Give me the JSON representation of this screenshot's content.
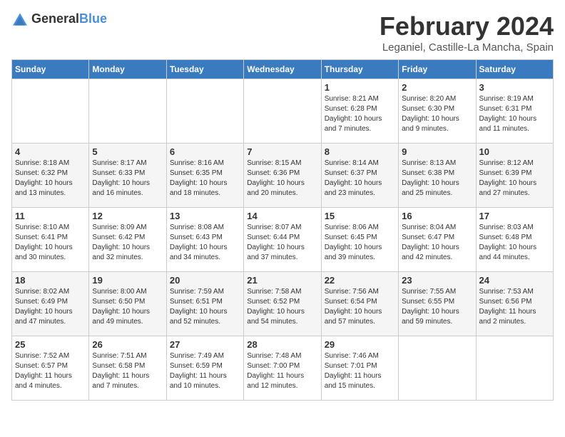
{
  "header": {
    "logo_general": "General",
    "logo_blue": "Blue",
    "month_title": "February 2024",
    "subtitle": "Leganiel, Castille-La Mancha, Spain"
  },
  "weekdays": [
    "Sunday",
    "Monday",
    "Tuesday",
    "Wednesday",
    "Thursday",
    "Friday",
    "Saturday"
  ],
  "weeks": [
    [
      {
        "day": "",
        "info": ""
      },
      {
        "day": "",
        "info": ""
      },
      {
        "day": "",
        "info": ""
      },
      {
        "day": "",
        "info": ""
      },
      {
        "day": "1",
        "info": "Sunrise: 8:21 AM\nSunset: 6:28 PM\nDaylight: 10 hours\nand 7 minutes."
      },
      {
        "day": "2",
        "info": "Sunrise: 8:20 AM\nSunset: 6:30 PM\nDaylight: 10 hours\nand 9 minutes."
      },
      {
        "day": "3",
        "info": "Sunrise: 8:19 AM\nSunset: 6:31 PM\nDaylight: 10 hours\nand 11 minutes."
      }
    ],
    [
      {
        "day": "4",
        "info": "Sunrise: 8:18 AM\nSunset: 6:32 PM\nDaylight: 10 hours\nand 13 minutes."
      },
      {
        "day": "5",
        "info": "Sunrise: 8:17 AM\nSunset: 6:33 PM\nDaylight: 10 hours\nand 16 minutes."
      },
      {
        "day": "6",
        "info": "Sunrise: 8:16 AM\nSunset: 6:35 PM\nDaylight: 10 hours\nand 18 minutes."
      },
      {
        "day": "7",
        "info": "Sunrise: 8:15 AM\nSunset: 6:36 PM\nDaylight: 10 hours\nand 20 minutes."
      },
      {
        "day": "8",
        "info": "Sunrise: 8:14 AM\nSunset: 6:37 PM\nDaylight: 10 hours\nand 23 minutes."
      },
      {
        "day": "9",
        "info": "Sunrise: 8:13 AM\nSunset: 6:38 PM\nDaylight: 10 hours\nand 25 minutes."
      },
      {
        "day": "10",
        "info": "Sunrise: 8:12 AM\nSunset: 6:39 PM\nDaylight: 10 hours\nand 27 minutes."
      }
    ],
    [
      {
        "day": "11",
        "info": "Sunrise: 8:10 AM\nSunset: 6:41 PM\nDaylight: 10 hours\nand 30 minutes."
      },
      {
        "day": "12",
        "info": "Sunrise: 8:09 AM\nSunset: 6:42 PM\nDaylight: 10 hours\nand 32 minutes."
      },
      {
        "day": "13",
        "info": "Sunrise: 8:08 AM\nSunset: 6:43 PM\nDaylight: 10 hours\nand 34 minutes."
      },
      {
        "day": "14",
        "info": "Sunrise: 8:07 AM\nSunset: 6:44 PM\nDaylight: 10 hours\nand 37 minutes."
      },
      {
        "day": "15",
        "info": "Sunrise: 8:06 AM\nSunset: 6:45 PM\nDaylight: 10 hours\nand 39 minutes."
      },
      {
        "day": "16",
        "info": "Sunrise: 8:04 AM\nSunset: 6:47 PM\nDaylight: 10 hours\nand 42 minutes."
      },
      {
        "day": "17",
        "info": "Sunrise: 8:03 AM\nSunset: 6:48 PM\nDaylight: 10 hours\nand 44 minutes."
      }
    ],
    [
      {
        "day": "18",
        "info": "Sunrise: 8:02 AM\nSunset: 6:49 PM\nDaylight: 10 hours\nand 47 minutes."
      },
      {
        "day": "19",
        "info": "Sunrise: 8:00 AM\nSunset: 6:50 PM\nDaylight: 10 hours\nand 49 minutes."
      },
      {
        "day": "20",
        "info": "Sunrise: 7:59 AM\nSunset: 6:51 PM\nDaylight: 10 hours\nand 52 minutes."
      },
      {
        "day": "21",
        "info": "Sunrise: 7:58 AM\nSunset: 6:52 PM\nDaylight: 10 hours\nand 54 minutes."
      },
      {
        "day": "22",
        "info": "Sunrise: 7:56 AM\nSunset: 6:54 PM\nDaylight: 10 hours\nand 57 minutes."
      },
      {
        "day": "23",
        "info": "Sunrise: 7:55 AM\nSunset: 6:55 PM\nDaylight: 10 hours\nand 59 minutes."
      },
      {
        "day": "24",
        "info": "Sunrise: 7:53 AM\nSunset: 6:56 PM\nDaylight: 11 hours\nand 2 minutes."
      }
    ],
    [
      {
        "day": "25",
        "info": "Sunrise: 7:52 AM\nSunset: 6:57 PM\nDaylight: 11 hours\nand 4 minutes."
      },
      {
        "day": "26",
        "info": "Sunrise: 7:51 AM\nSunset: 6:58 PM\nDaylight: 11 hours\nand 7 minutes."
      },
      {
        "day": "27",
        "info": "Sunrise: 7:49 AM\nSunset: 6:59 PM\nDaylight: 11 hours\nand 10 minutes."
      },
      {
        "day": "28",
        "info": "Sunrise: 7:48 AM\nSunset: 7:00 PM\nDaylight: 11 hours\nand 12 minutes."
      },
      {
        "day": "29",
        "info": "Sunrise: 7:46 AM\nSunset: 7:01 PM\nDaylight: 11 hours\nand 15 minutes."
      },
      {
        "day": "",
        "info": ""
      },
      {
        "day": "",
        "info": ""
      }
    ]
  ]
}
